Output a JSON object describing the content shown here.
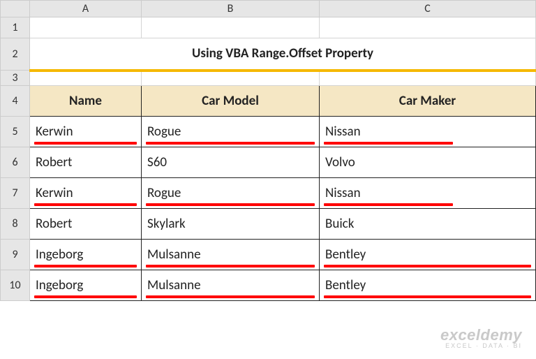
{
  "columns": [
    "A",
    "B",
    "C"
  ],
  "rows": [
    "1",
    "2",
    "3",
    "4",
    "5",
    "6",
    "7",
    "8",
    "9",
    "10"
  ],
  "title": "Using VBA Range.Offset Property",
  "headers": {
    "name": "Name",
    "model": "Car Model",
    "maker": "Car Maker"
  },
  "data": [
    {
      "name": "Kerwin",
      "model": "Rogue",
      "maker": "Nissan",
      "hl": true,
      "hlShort": true
    },
    {
      "name": "Robert",
      "model": "S60",
      "maker": "Volvo",
      "hl": false,
      "hlShort": false
    },
    {
      "name": "Kerwin",
      "model": "Rogue",
      "maker": "Nissan",
      "hl": true,
      "hlShort": true
    },
    {
      "name": "Robert",
      "model": "Skylark",
      "maker": "Buick",
      "hl": false,
      "hlShort": false
    },
    {
      "name": "Ingeborg",
      "model": "Mulsanne",
      "maker": "Bentley",
      "hl": true,
      "hlShort": false
    },
    {
      "name": "Ingeborg",
      "model": "Mulsanne",
      "maker": "Bentley",
      "hl": true,
      "hlShort": false
    }
  ],
  "watermark": {
    "brand": "exceldemy",
    "tag": "EXCEL · DATA · BI"
  }
}
